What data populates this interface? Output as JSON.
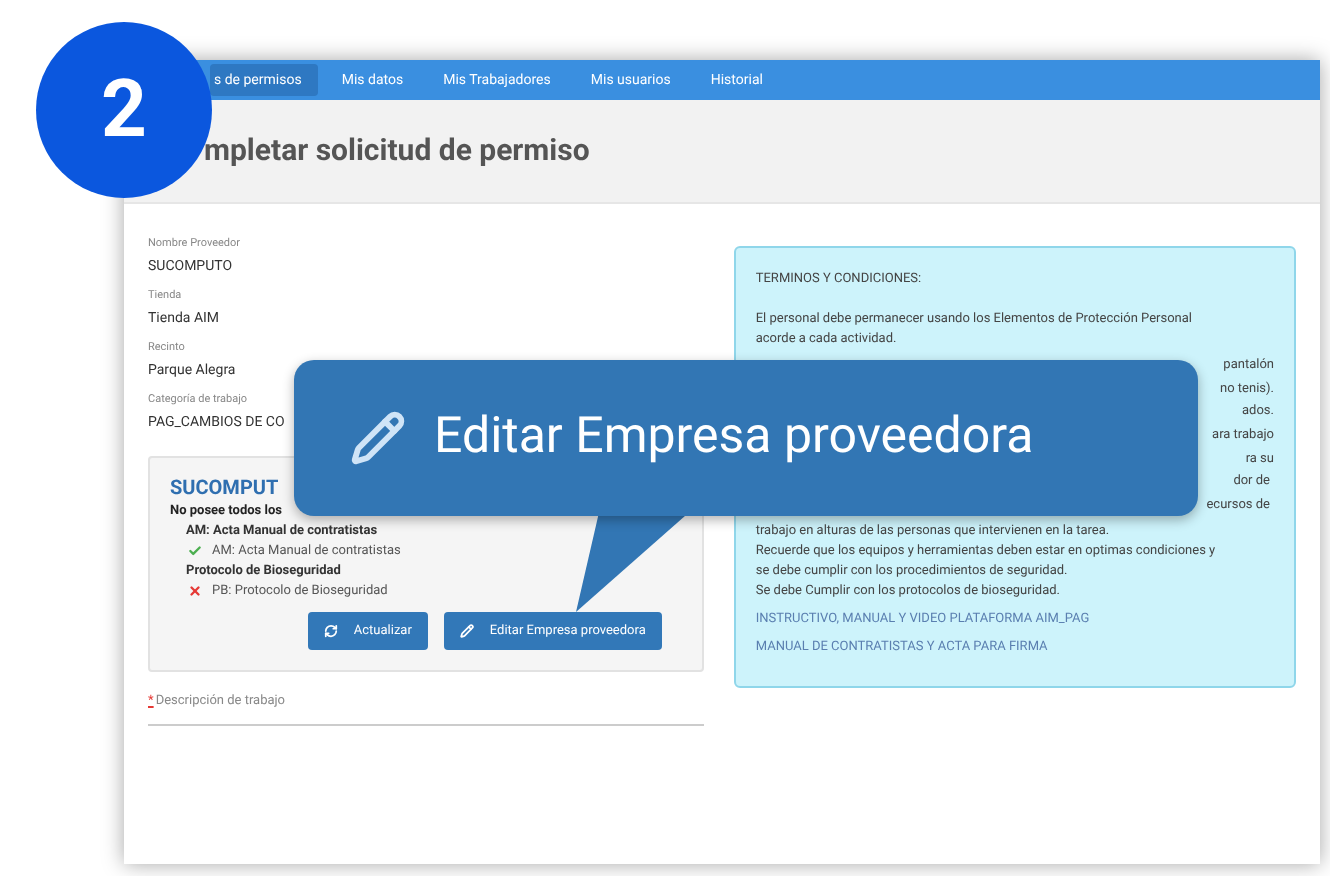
{
  "step_badge": "2",
  "tabs": [
    {
      "label": "s de permisos",
      "selected": true
    },
    {
      "label": "Mis datos",
      "selected": false
    },
    {
      "label": "Mis Trabajadores",
      "selected": false
    },
    {
      "label": "Mis usuarios",
      "selected": false
    },
    {
      "label": "Historial",
      "selected": false
    }
  ],
  "page_title": "mpletar solicitud de permiso",
  "fields": [
    {
      "label": "Nombre Proveedor",
      "value": "SUCOMPUTO"
    },
    {
      "label": "Tienda",
      "value": "Tienda AIM"
    },
    {
      "label": "Recinto",
      "value": "Parque Alegra"
    },
    {
      "label": "Categoría de trabajo",
      "value": "PAG_CAMBIOS DE CO"
    }
  ],
  "provider_card": {
    "name": "SUCOMPUT",
    "notice": "No posee todos los",
    "groups": [
      {
        "title": "AM: Acta Manual de contratistas",
        "items": [
          {
            "label": "AM: Acta Manual de contratistas",
            "complete": true
          }
        ]
      },
      {
        "title": "Protocolo de Bioseguridad",
        "items": [
          {
            "label": "PB: Protocolo de Bioseguridad",
            "complete": false
          }
        ]
      }
    ],
    "buttons": [
      {
        "label": "Actualizar",
        "kind": "refresh"
      },
      {
        "label": "Editar Empresa proveedora",
        "kind": "edit"
      }
    ]
  },
  "description_field": {
    "required_mark": "*",
    "label": "Descripción de trabajo"
  },
  "terms": {
    "heading": "TERMINOS Y CONDICIONES:",
    "lines_top": [
      "El personal debe permanecer usando los Elementos de Protección Personal",
      "acorde a cada actividad."
    ],
    "partial_lines": [
      "pantalón",
      "no tenis).",
      "ados.",
      "ara trabajo",
      "ra su",
      "dor de",
      "ecursos de"
    ],
    "lines_bottom": [
      "trabajo en alturas de las personas que intervienen en la tarea.",
      "Recuerde que los equipos y herramientas deben estar en optimas condiciones y",
      "se debe cumplir con los procedimientos de seguridad.",
      "Se debe Cumplir con los protocolos de bioseguridad."
    ],
    "links": [
      "INSTRUCTIVO, MANUAL Y VIDEO PLATAFORMA AIM_PAG",
      "MANUAL DE CONTRATISTAS Y ACTA PARA FIRMA"
    ]
  },
  "callout": {
    "text": "Editar Empresa proveedora"
  }
}
